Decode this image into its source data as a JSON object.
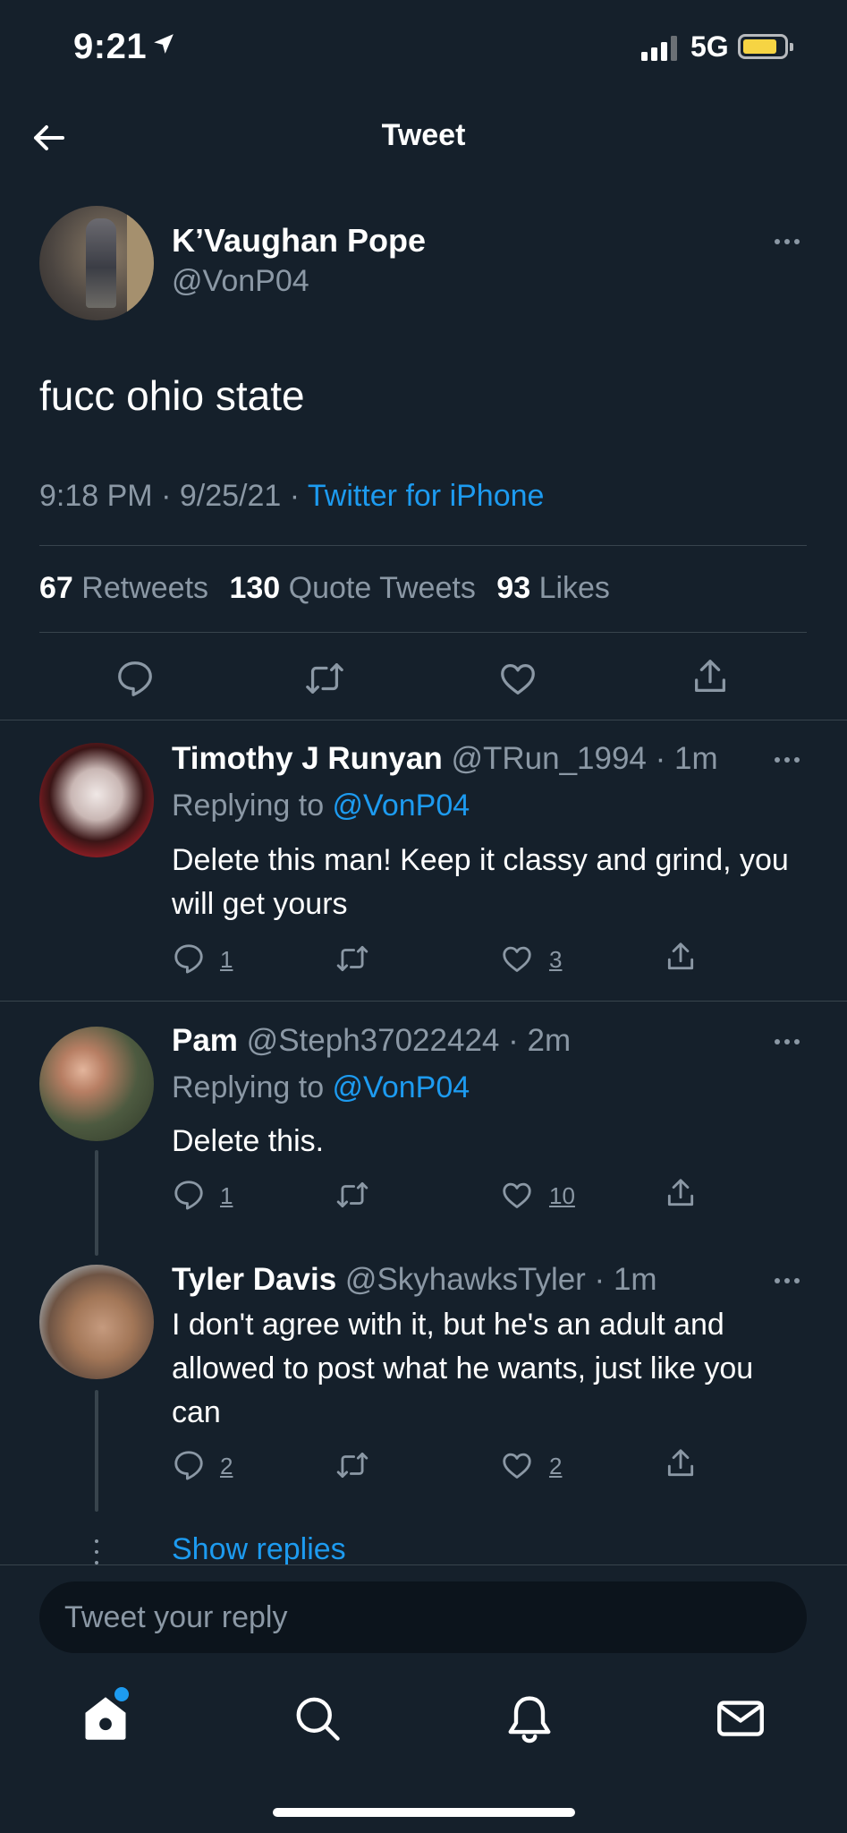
{
  "status_bar": {
    "time": "9:21",
    "network": "5G"
  },
  "header": {
    "title": "Tweet"
  },
  "tweet": {
    "name": "K’Vaughan Pope",
    "handle": "@VonP04",
    "text": "fucc ohio state",
    "timestamp": "9:18 PM · 9/25/21 · ",
    "source": "Twitter for iPhone",
    "retweets_count": "67",
    "retweets_label": "Retweets",
    "quotes_count": "130",
    "quotes_label": "Quote Tweets",
    "likes_count": "93",
    "likes_label": "Likes"
  },
  "replies": [
    {
      "name": "Timothy J Runyan",
      "meta": " @TRun_1994 · 1m",
      "replying_prefix": "Replying to ",
      "replying_to": "@VonP04",
      "text": "Delete this man! Keep it classy and grind, you will get yours",
      "reply_count": "1",
      "like_count": "3"
    },
    {
      "name": "Pam",
      "meta": " @Steph37022424 · 2m",
      "replying_prefix": "Replying to ",
      "replying_to": "@VonP04",
      "text": "Delete this.",
      "reply_count": "1",
      "like_count": "10"
    },
    {
      "name": "Tyler Davis",
      "meta": " @SkyhawksTyler · 1m",
      "text": "I don't agree with it, but he's an adult and allowed to post what he wants, just like you can",
      "reply_count": "2",
      "like_count": "2"
    }
  ],
  "show_replies": "Show replies",
  "compose": {
    "placeholder": "Tweet your reply"
  },
  "colors": {
    "background": "#15202b",
    "accent": "#1d9bf0",
    "secondary_text": "#8b98a5",
    "battery": "#f6d443"
  },
  "icons": [
    "location-arrow-icon",
    "back-arrow-icon",
    "more-icon",
    "reply-icon",
    "retweet-icon",
    "like-icon",
    "share-icon",
    "home-icon",
    "search-icon",
    "bell-icon",
    "mail-icon"
  ]
}
